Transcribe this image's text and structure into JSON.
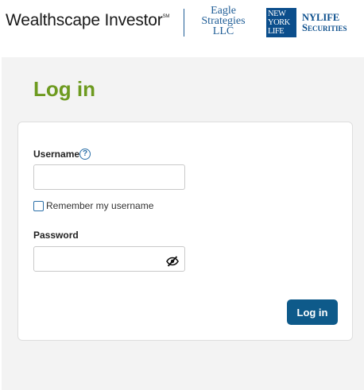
{
  "header": {
    "brand_name": "Wealthscape Investor",
    "brand_mark": "SM",
    "eagle_line1": "Eagle",
    "eagle_line2": "Strategies",
    "eagle_line3": "LLC",
    "ny_box_line1": "NEW",
    "ny_box_line2": "YORK",
    "ny_box_line3": "LIFE",
    "ny_sec_line1": "NYLIFE",
    "ny_sec_line2": "Securities"
  },
  "login": {
    "title": "Log in",
    "username_label": "Username",
    "help_glyph": "?",
    "username_value": "",
    "remember_label": "Remember my username",
    "remember_checked": false,
    "password_label": "Password",
    "password_value": "",
    "show_password_icon": "eye-slash-icon",
    "submit_label": "Log in"
  },
  "colors": {
    "title_green": "#6d9a1f",
    "button_blue": "#0e5a8a",
    "link_blue": "#2b6fa8",
    "brand_blue": "#1f5d96",
    "panel_gray": "#f3f3f3"
  }
}
